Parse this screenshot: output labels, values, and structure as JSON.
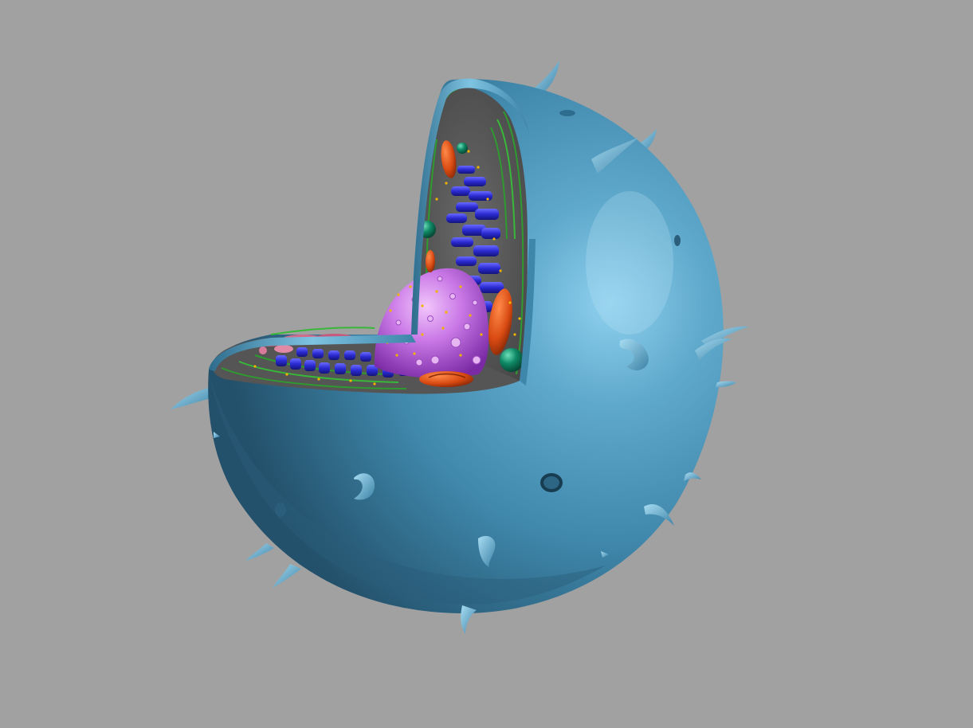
{
  "scene": {
    "subject": "animal-cell-cutaway",
    "background_color": "#a1a1a1",
    "colors": {
      "membrane": "#3f87ab",
      "membrane_highlight": "#9fd6ee",
      "membrane_shadow": "#1d4860",
      "cytoplasm": "#5b5b5b",
      "nucleus": "#c070e0",
      "nucleus_pore": "#e7b6f2",
      "endoplasmic_reticulum": "#2a2ad2",
      "mitochondria": "#d84a12",
      "golgi": "#c65a7c",
      "lysosome": "#0f8a66",
      "membrane_layers": "#2f9a2f",
      "ribosome": "#f0b400"
    },
    "organelles": [
      {
        "name": "cell-membrane"
      },
      {
        "name": "cytoplasm"
      },
      {
        "name": "nucleus"
      },
      {
        "name": "rough-endoplasmic-reticulum"
      },
      {
        "name": "mitochondria"
      },
      {
        "name": "golgi-apparatus"
      },
      {
        "name": "lysosome"
      },
      {
        "name": "ribosomes"
      },
      {
        "name": "microvilli"
      }
    ]
  }
}
